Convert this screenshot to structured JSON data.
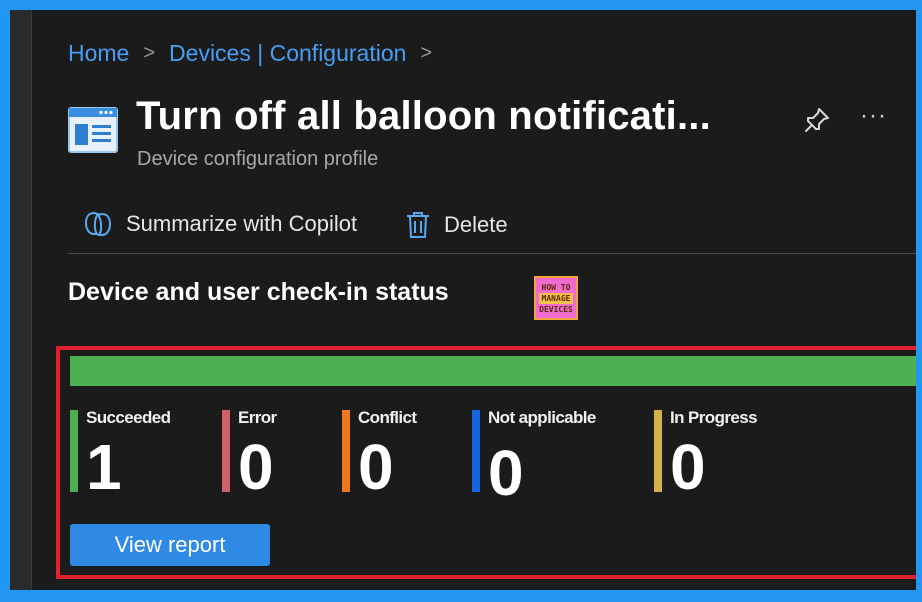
{
  "breadcrumb": {
    "home": "Home",
    "section": "Devices | Configuration"
  },
  "header": {
    "title": "Turn off all balloon notificati...",
    "subtitle": "Device configuration profile",
    "icon": "profile-window-icon",
    "pin_icon": "pin-icon",
    "more_label": "···"
  },
  "commands": {
    "copilot_label": "Summarize with Copilot",
    "delete_label": "Delete"
  },
  "section": {
    "title": "Device and user check-in status",
    "logo_lines": [
      "HOW TO",
      "MANAGE",
      "DEVICES"
    ]
  },
  "status": {
    "progress_fraction": 1.0,
    "progress_color": "#4caf50",
    "items": [
      {
        "label": "Succeeded",
        "value": "1",
        "color": "#4caf50"
      },
      {
        "label": "Error",
        "value": "0",
        "color": "#d0606a"
      },
      {
        "label": "Conflict",
        "value": "0",
        "color": "#f07820"
      },
      {
        "label": "Not applicable",
        "value": "0",
        "color": "#1565e0"
      },
      {
        "label": "In Progress",
        "value": "0",
        "color": "#d4b24a"
      }
    ],
    "view_report_label": "View report"
  },
  "colors": {
    "accent": "#479ef5",
    "highlight_border": "#e0202c",
    "button": "#2f8ae6"
  }
}
